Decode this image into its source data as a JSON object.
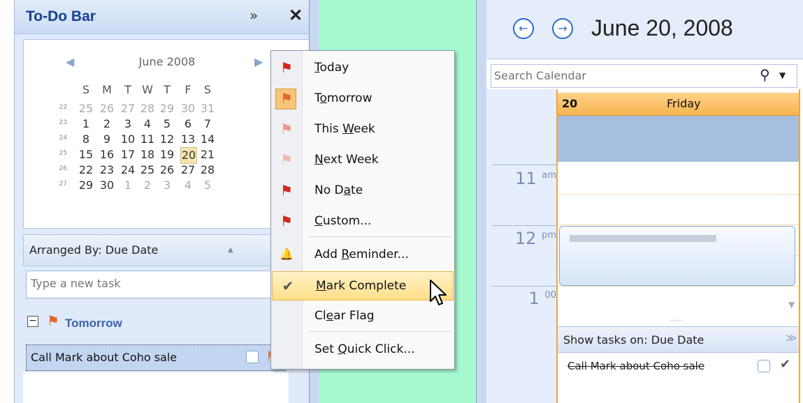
{
  "todo_bar": {
    "title": "To-Do Bar",
    "expand_glyph": "»",
    "close_glyph": "✕"
  },
  "mini_calendar": {
    "month_label": "June 2008",
    "days_of_week": [
      "S",
      "M",
      "T",
      "W",
      "T",
      "F",
      "S"
    ],
    "weeks": [
      {
        "num": "22",
        "days": [
          "25",
          "26",
          "27",
          "28",
          "29",
          "30",
          "31"
        ],
        "dim": [
          1,
          1,
          1,
          1,
          1,
          1,
          1
        ]
      },
      {
        "num": "23",
        "days": [
          "1",
          "2",
          "3",
          "4",
          "5",
          "6",
          "7"
        ],
        "dim": [
          0,
          0,
          0,
          0,
          0,
          0,
          0
        ]
      },
      {
        "num": "24",
        "days": [
          "8",
          "9",
          "10",
          "11",
          "12",
          "13",
          "14"
        ],
        "dim": [
          0,
          0,
          0,
          0,
          0,
          0,
          0
        ]
      },
      {
        "num": "25",
        "days": [
          "15",
          "16",
          "17",
          "18",
          "19",
          "20",
          "21"
        ],
        "dim": [
          0,
          0,
          0,
          0,
          0,
          0,
          0
        ]
      },
      {
        "num": "26",
        "days": [
          "22",
          "23",
          "24",
          "25",
          "26",
          "27",
          "28"
        ],
        "dim": [
          0,
          0,
          0,
          0,
          0,
          0,
          0
        ]
      },
      {
        "num": "27",
        "days": [
          "29",
          "30",
          "1",
          "2",
          "3",
          "4",
          "5"
        ],
        "dim": [
          0,
          0,
          1,
          1,
          1,
          1,
          1
        ]
      }
    ],
    "selected_day": "20"
  },
  "task_list": {
    "arranged_by": "Arranged By: Due Date",
    "new_task_placeholder": "Type a new task",
    "group_label": "Tomorrow",
    "collapse_glyph": "−",
    "task": "Call Mark about Coho sale"
  },
  "context_menu": {
    "items": [
      {
        "label": "Today",
        "icon": "flag-red-icon",
        "underline": "T"
      },
      {
        "label": "Tomorrow",
        "icon": "flag-orange-icon",
        "underline": "o"
      },
      {
        "label": "This Week",
        "icon": "flag-pink-icon",
        "underline": "W"
      },
      {
        "label": "Next Week",
        "icon": "flag-pale-icon",
        "underline": "N"
      },
      {
        "label": "No Date",
        "icon": "flag-red-icon",
        "underline": "a"
      },
      {
        "label": "Custom...",
        "icon": "flag-red-icon",
        "underline": "C"
      },
      {
        "label": "Add Reminder...",
        "icon": "bell-icon",
        "underline": "R"
      },
      {
        "label": "Mark Complete",
        "icon": "checkmark-icon",
        "underline": "M"
      },
      {
        "label": "Clear Flag",
        "icon": "",
        "underline": "e"
      },
      {
        "label": "Set Quick Click...",
        "icon": "",
        "underline": "Q"
      }
    ],
    "highlighted": "Mark Complete"
  },
  "calendar": {
    "prev_glyph": "←",
    "next_glyph": "→",
    "date_title": "June 20, 2008",
    "search_placeholder": "Search Calendar",
    "day_number": "20",
    "day_name": "Friday",
    "hours": [
      {
        "h": "11",
        "s": "am"
      },
      {
        "h": "12",
        "s": "pm"
      },
      {
        "h": "1",
        "s": "00"
      }
    ],
    "show_tasks_on": "Show tasks on: Due Date",
    "completed_task": "Call Mark about Coho sale"
  },
  "colors": {
    "accent": "#15428b",
    "flag_orange": "#e06a2a",
    "today_highlight": "#f3e5b1",
    "green_pane": "#a6fad0"
  }
}
